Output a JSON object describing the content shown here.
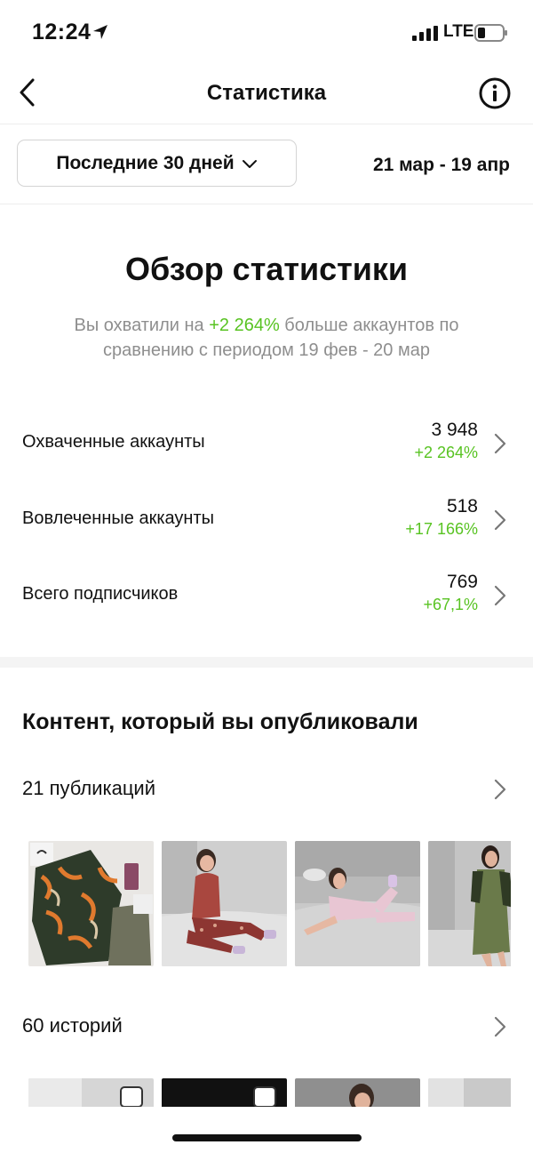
{
  "status_bar": {
    "time": "12:24",
    "network": "LTE"
  },
  "nav": {
    "title": "Статистика"
  },
  "filter": {
    "period": "Последние 30 дней",
    "date_range": "21 мар - 19 апр"
  },
  "overview": {
    "title": "Обзор статистики",
    "desc_prefix": "Вы охватили на ",
    "desc_highlight": "+2 264%",
    "desc_suffix": " больше аккаунтов по сравнению с периодом 19 фев - 20 мар"
  },
  "metrics": [
    {
      "label": "Охваченные аккаунты",
      "value": "3 948",
      "change": "+2 264%"
    },
    {
      "label": "Вовлеченные аккаунты",
      "value": "518",
      "change": "+17 166%"
    },
    {
      "label": "Всего подписчиков",
      "value": "769",
      "change": "+67,1%"
    }
  ],
  "content": {
    "title": "Контент, который вы опубликовали",
    "posts_label": "21 публикаций",
    "stories_label": "60 историй"
  },
  "colors": {
    "positive": "#58c322",
    "muted": "#8e8e8e"
  }
}
